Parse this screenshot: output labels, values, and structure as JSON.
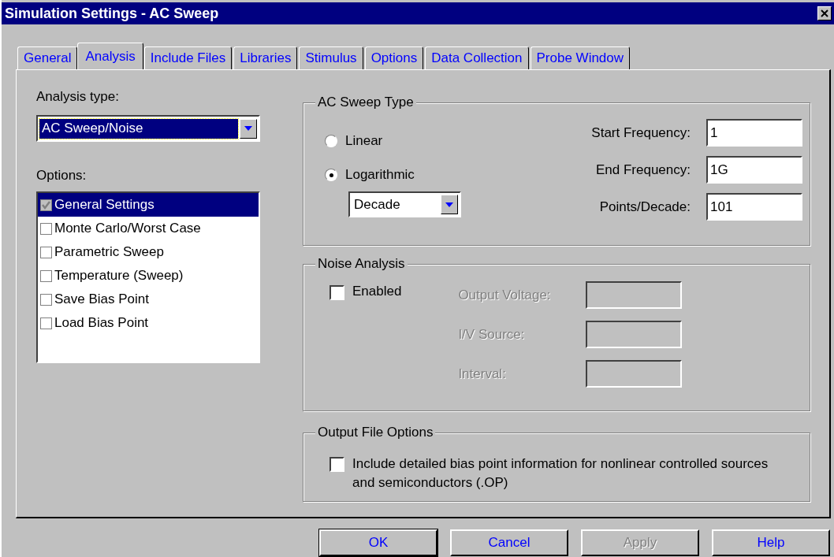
{
  "window": {
    "title": "Simulation Settings - AC Sweep"
  },
  "tabs": [
    {
      "label": "General",
      "selected": false
    },
    {
      "label": "Analysis",
      "selected": true
    },
    {
      "label": "Include Files",
      "selected": false
    },
    {
      "label": "Libraries",
      "selected": false
    },
    {
      "label": "Stimulus",
      "selected": false
    },
    {
      "label": "Options",
      "selected": false
    },
    {
      "label": "Data Collection",
      "selected": false
    },
    {
      "label": "Probe Window",
      "selected": false
    }
  ],
  "analysis_type": {
    "label": "Analysis type:",
    "value": "AC Sweep/Noise"
  },
  "options": {
    "label": "Options:",
    "items": [
      {
        "label": "General Settings",
        "checked": true,
        "selected": true
      },
      {
        "label": "Monte Carlo/Worst Case",
        "checked": false,
        "selected": false
      },
      {
        "label": "Parametric Sweep",
        "checked": false,
        "selected": false
      },
      {
        "label": "Temperature (Sweep)",
        "checked": false,
        "selected": false
      },
      {
        "label": "Save Bias Point",
        "checked": false,
        "selected": false
      },
      {
        "label": "Load Bias Point",
        "checked": false,
        "selected": false
      }
    ]
  },
  "ac_sweep_type": {
    "title": "AC Sweep Type",
    "modes": [
      {
        "label": "Linear",
        "selected": false
      },
      {
        "label": "Logarithmic",
        "selected": true
      }
    ],
    "step": {
      "value": "Decade"
    },
    "fields": [
      {
        "label": "Start Frequency:",
        "value": "1"
      },
      {
        "label": "End Frequency:",
        "value": "1G"
      },
      {
        "label": "Points/Decade:",
        "value": "101"
      }
    ]
  },
  "noise_analysis": {
    "title": "Noise Analysis",
    "enabled": {
      "label": "Enabled",
      "checked": false
    },
    "fields": [
      {
        "label": "Output Voltage:",
        "disabled": true
      },
      {
        "label": "I/V Source:",
        "disabled": true
      },
      {
        "label": "Interval:",
        "disabled": true
      }
    ]
  },
  "output_file_options": {
    "title": "Output File Options",
    "option": {
      "label": "Include detailed bias point information for nonlinear controlled sources and semiconductors (.OP)",
      "checked": false
    }
  },
  "buttons": [
    {
      "label": "OK",
      "disabled": false
    },
    {
      "label": "Cancel",
      "disabled": false
    },
    {
      "label": "Apply",
      "disabled": true
    },
    {
      "label": "Help",
      "disabled": false
    }
  ]
}
